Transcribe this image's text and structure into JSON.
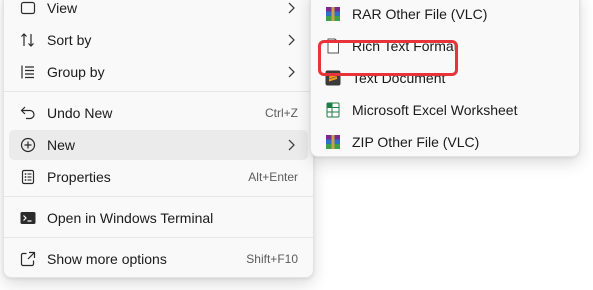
{
  "main_menu": {
    "items": [
      {
        "label": "View",
        "icon": "view-icon",
        "has_submenu": true
      },
      {
        "label": "Sort by",
        "icon": "sort-icon",
        "has_submenu": true
      },
      {
        "label": "Group by",
        "icon": "group-icon",
        "has_submenu": true
      },
      {
        "label": "Undo New",
        "icon": "undo-icon",
        "shortcut": "Ctrl+Z"
      },
      {
        "label": "New",
        "icon": "new-icon",
        "has_submenu": true,
        "state": "hovered"
      },
      {
        "label": "Properties",
        "icon": "properties-icon",
        "shortcut": "Alt+Enter"
      },
      {
        "label": "Open in Windows Terminal",
        "icon": "terminal-icon"
      },
      {
        "label": "Show more options",
        "icon": "show-more-icon",
        "shortcut": "Shift+F10"
      }
    ]
  },
  "new_submenu": {
    "items": [
      {
        "label": "RAR Other File (VLC)",
        "icon": "rar-archive-icon"
      },
      {
        "label": "Rich Text Format",
        "icon": "rtf-document-icon"
      },
      {
        "label": "Text Document",
        "icon": "sublime-text-icon",
        "highlighted": true
      },
      {
        "label": "Microsoft Excel Worksheet",
        "icon": "excel-icon"
      },
      {
        "label": "ZIP Other File (VLC)",
        "icon": "zip-archive-icon"
      }
    ]
  },
  "colors": {
    "highlight_border": "#e8333a",
    "menu_background": "#f9f9f9",
    "hover_background": "#ebebeb"
  }
}
